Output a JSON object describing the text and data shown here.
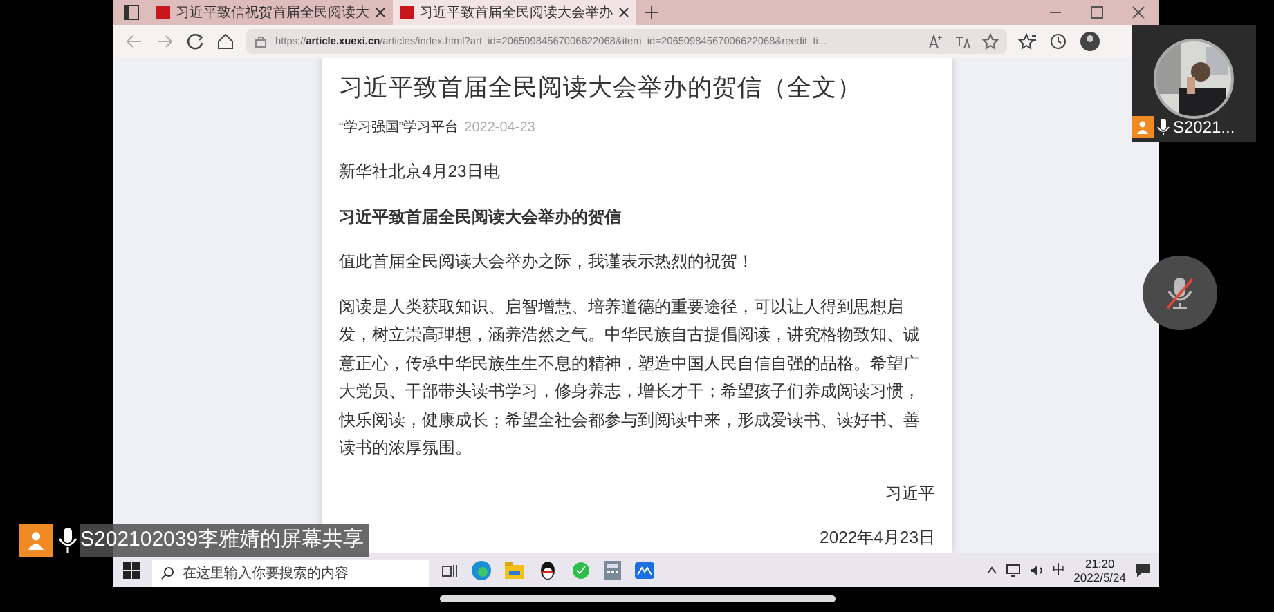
{
  "browser": {
    "tabs": [
      {
        "title": "习近平致信祝贺首届全民阅读大",
        "selected": false
      },
      {
        "title": "习近平致首届全民阅读大会举办",
        "selected": true
      }
    ],
    "url_prefix": "https://",
    "url_host": "article.xuexi.cn",
    "url_rest": "/articles/index.html?art_id=20650984567006622068&item_id=20650984567006622068&reedit_ti..."
  },
  "article": {
    "title": "习近平致首届全民阅读大会举办的贺信（全文）",
    "source": "“学习强国”学习平台",
    "date": "2022-04-23",
    "blocks": [
      {
        "kind": "text",
        "text": "新华社北京4月23日电"
      },
      {
        "kind": "heading",
        "text": "习近平致首届全民阅读大会举办的贺信"
      },
      {
        "kind": "text",
        "text": "值此首届全民阅读大会举办之际，我谨表示热烈的祝贺！"
      },
      {
        "kind": "text",
        "text": "阅读是人类获取知识、启智增慧、培养道德的重要途径，可以让人得到思想启发，树立崇高理想，涵养浩然之气。中华民族自古提倡阅读，讲究格物致知、诚意正心，传承中华民族生生不息的精神，塑造中国人民自信自强的品格。希望广大党员、干部带头读书学习，修身养志，增长才干；希望孩子们养成阅读习惯，快乐阅读，健康成长；希望全社会都参与到阅读中来，形成爱读书、读好书、善读书的浓厚氛围。"
      },
      {
        "kind": "signature",
        "text": "习近平"
      },
      {
        "kind": "signature",
        "text": "2022年4月23日"
      }
    ]
  },
  "taskbar": {
    "search_placeholder": "在这里输入你要搜索的内容",
    "ime": "中",
    "time": "21:20",
    "date": "2022/5/24"
  },
  "meeting": {
    "participant": {
      "name": "S2021...",
      "muted": false
    },
    "share_label": "S202102039李雅婧的屏幕共享",
    "mic_muted": true
  }
}
